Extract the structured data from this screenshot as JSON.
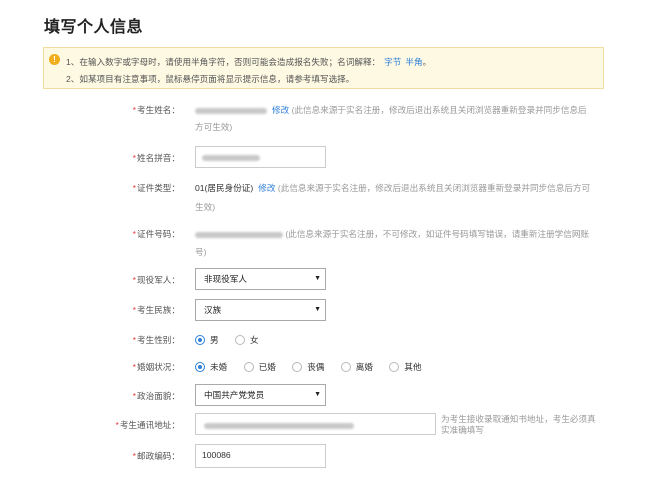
{
  "page_title": "填写个人信息",
  "notice": {
    "line1": "1、在输入数字或字母时，请使用半角字符，否则可能会造成报名失败；名词解释：",
    "link1": "字节",
    "link2": "半角",
    "line1_end": "。",
    "line2": "2、如某项目有注意事项，鼠标悬停页面将显示提示信息，请参考填写选择。"
  },
  "fields": {
    "name": {
      "label": "考生姓名：",
      "edit": "修改",
      "note_line1": "(此信息来源于实名注册，修改后退出系统且关闭浏览器重新登录并同步信息后",
      "note_line2": "方可生效)"
    },
    "pinyin": {
      "label": "姓名拼音："
    },
    "id_type": {
      "label": "证件类型：",
      "value": "01(居民身份证)",
      "edit": "修改",
      "note_line1": "(此信息来源于实名注册，修改后退出系统且关闭浏览器重新登录并同步信息后方可",
      "note_line2": "生效)"
    },
    "id_number": {
      "label": "证件号码：",
      "note_line1": "(此信息来源于实名注册，不可修改，如证件号码填写错误，请重新注册学信网账",
      "note_line2": "号)"
    },
    "veteran": {
      "label": "现役军人：",
      "value": "非现役军人"
    },
    "ethnicity": {
      "label": "考生民族：",
      "value": "汉族"
    },
    "gender": {
      "label": "考生性别：",
      "options": [
        "男",
        "女"
      ]
    },
    "marital": {
      "label": "婚姻状况：",
      "options": [
        "未婚",
        "已婚",
        "丧偶",
        "离婚",
        "其他"
      ]
    },
    "political": {
      "label": "政治面貌：",
      "value": "中国共产党党员"
    },
    "address": {
      "label": "考生通讯地址：",
      "hint_line1": "为考生接收录取通知书地址，考生必须真",
      "hint_line2": "实准确填写"
    },
    "postcode": {
      "label": "邮政编码：",
      "value": "100086"
    }
  },
  "required_mark": "*",
  "colors": {
    "accent": "#2f7fd8",
    "required": "#e4393c",
    "notice_bg": "#fdf9e3"
  }
}
